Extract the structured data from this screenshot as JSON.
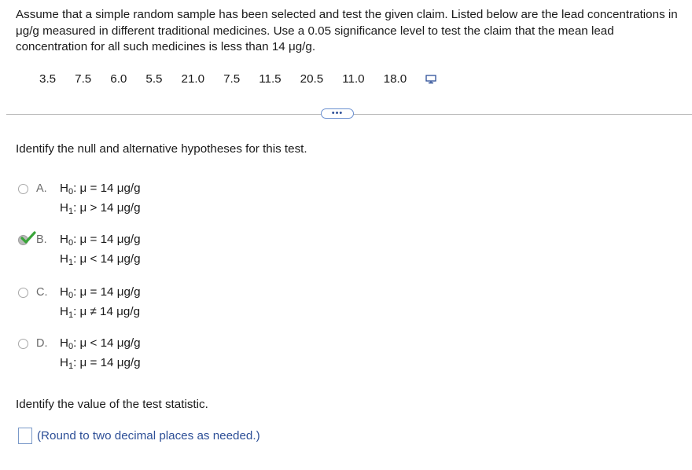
{
  "prompt": "Assume that a simple random sample has been selected and test the given claim. Listed below are the lead concentrations in μg/g measured in different traditional medicines. Use a 0.05 significance level to test the claim that the mean lead concentration for all such medicines is less than 14 μg/g.",
  "data_values": [
    "3.5",
    "7.5",
    "6.0",
    "5.5",
    "21.0",
    "7.5",
    "11.5",
    "20.5",
    "11.0",
    "18.0"
  ],
  "more_button_label": "•••",
  "question1": "Identify the null and alternative hypotheses for this test.",
  "options": [
    {
      "letter": "A.",
      "h0_sym": "H",
      "h0_sub": "0",
      "h0_expr": ": μ = 14 μg/g",
      "h1_sym": "H",
      "h1_sub": "1",
      "h1_expr": ": μ > 14 μg/g",
      "selected": false
    },
    {
      "letter": "B.",
      "h0_sym": "H",
      "h0_sub": "0",
      "h0_expr": ": μ = 14 μg/g",
      "h1_sym": "H",
      "h1_sub": "1",
      "h1_expr": ": μ < 14 μg/g",
      "selected": true
    },
    {
      "letter": "C.",
      "h0_sym": "H",
      "h0_sub": "0",
      "h0_expr": ": μ = 14 μg/g",
      "h1_sym": "H",
      "h1_sub": "1",
      "h1_expr": ": μ ≠ 14 μg/g",
      "selected": false
    },
    {
      "letter": "D.",
      "h0_sym": "H",
      "h0_sub": "0",
      "h0_expr": ": μ < 14 μg/g",
      "h1_sym": "H",
      "h1_sub": "1",
      "h1_expr": ": μ = 14 μg/g",
      "selected": false
    }
  ],
  "question2": "Identify the value of the test statistic.",
  "answer_value": "",
  "hint": "(Round to two decimal places as needed.)",
  "colors": {
    "accent": "#2d4f97",
    "check": "#3aa53a"
  }
}
